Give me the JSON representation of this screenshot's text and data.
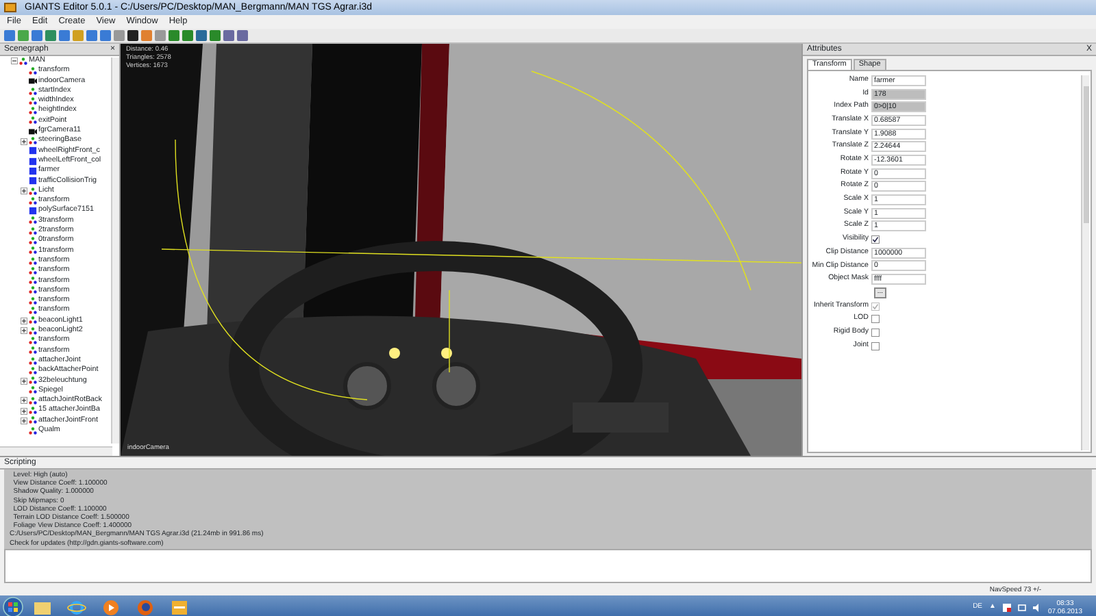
{
  "window": {
    "title": "GIANTS Editor 5.0.1 - C:/Users/PC/Desktop/MAN_Bergmann/MAN TGS Agrar.i3d"
  },
  "menu": [
    "File",
    "Edit",
    "Create",
    "View",
    "Window",
    "Help"
  ],
  "scenegraph": {
    "title": "Scenegraph",
    "close": "×",
    "tree": [
      {
        "label": "MAN",
        "kind": "transform",
        "expanded": true,
        "children": [
          {
            "label": "transform",
            "kind": "transform"
          },
          {
            "label": "indoorCamera",
            "kind": "camera"
          },
          {
            "label": "startIndex",
            "kind": "transform"
          },
          {
            "label": "widthIndex",
            "kind": "transform"
          },
          {
            "label": "heightIndex",
            "kind": "transform"
          },
          {
            "label": "exitPoint",
            "kind": "transform"
          },
          {
            "label": "fgrCamera11",
            "kind": "camera"
          },
          {
            "label": "steeringBase",
            "kind": "transform",
            "expanded": false
          },
          {
            "label": "wheelRightFront_c",
            "kind": "shape"
          },
          {
            "label": "wheelLeftFront_col",
            "kind": "shape"
          },
          {
            "label": "farmer",
            "kind": "shape"
          },
          {
            "label": "trafficCollisionTrig",
            "kind": "shape"
          },
          {
            "label": "Licht",
            "kind": "transform",
            "expanded": false
          },
          {
            "label": "transform",
            "kind": "transform"
          },
          {
            "label": "polySurface7151",
            "kind": "shape"
          },
          {
            "label": "3transform",
            "kind": "transform"
          },
          {
            "label": "2transform",
            "kind": "transform"
          },
          {
            "label": "0transform",
            "kind": "transform"
          },
          {
            "label": "1transform",
            "kind": "transform"
          },
          {
            "label": "transform",
            "kind": "transform"
          },
          {
            "label": "transform",
            "kind": "transform"
          },
          {
            "label": "transform",
            "kind": "transform"
          },
          {
            "label": "transform",
            "kind": "transform"
          },
          {
            "label": "transform",
            "kind": "transform"
          },
          {
            "label": "transform",
            "kind": "transform"
          },
          {
            "label": "beaconLight1",
            "kind": "transform",
            "expanded": false
          },
          {
            "label": "beaconLight2",
            "kind": "transform",
            "expanded": false
          },
          {
            "label": "transform",
            "kind": "transform"
          },
          {
            "label": "transform",
            "kind": "transform"
          },
          {
            "label": "attacherJoint",
            "kind": "transform"
          },
          {
            "label": "backAttacherPoint",
            "kind": "transform"
          },
          {
            "label": "32beleuchtung",
            "kind": "transform",
            "expanded": false
          },
          {
            "label": "Spiegel",
            "kind": "transform"
          },
          {
            "label": "attachJointRotBack",
            "kind": "transform",
            "expanded": false
          },
          {
            "label": "15 attacherJointBa",
            "kind": "transform",
            "expanded": false
          },
          {
            "label": "attacherJointFront",
            "kind": "transform",
            "expanded": false
          },
          {
            "label": "Qualm",
            "kind": "transform"
          }
        ]
      }
    ]
  },
  "viewport": {
    "stats": [
      "Distance: 0.46",
      "Triangles: 2578",
      "Vertices: 1673"
    ],
    "camera": "indoorCamera"
  },
  "attributes": {
    "title": "Attributes",
    "close": "X",
    "tabs": [
      {
        "label": "Transform",
        "selected": true
      },
      {
        "label": "Shape",
        "selected": false
      }
    ],
    "fields": [
      {
        "kind": "text",
        "label": "Name",
        "value": "farmer"
      },
      {
        "kind": "readonly",
        "label": "Id",
        "value": "178"
      },
      {
        "kind": "readonly",
        "label": "Index Path",
        "value": "0>0|10"
      },
      {
        "kind": "text",
        "label": "Translate X",
        "value": "0.68587"
      },
      {
        "kind": "text",
        "label": "Translate Y",
        "value": "1.9088"
      },
      {
        "kind": "text",
        "label": "Translate Z",
        "value": "2.24644"
      },
      {
        "kind": "text",
        "label": "Rotate X",
        "value": "-12.3601"
      },
      {
        "kind": "text",
        "label": "Rotate Y",
        "value": "0"
      },
      {
        "kind": "text",
        "label": "Rotate Z",
        "value": "0"
      },
      {
        "kind": "text",
        "label": "Scale X",
        "value": "1"
      },
      {
        "kind": "text",
        "label": "Scale Y",
        "value": "1"
      },
      {
        "kind": "text",
        "label": "Scale Z",
        "value": "1"
      },
      {
        "kind": "checkbox",
        "label": "Visibility",
        "checked": true
      },
      {
        "kind": "text",
        "label": "Clip Distance",
        "value": "1000000"
      },
      {
        "kind": "text",
        "label": "Min Clip Distance",
        "value": "0"
      },
      {
        "kind": "text",
        "label": "Object Mask",
        "value": "ffff"
      },
      {
        "kind": "button",
        "value": "..."
      },
      {
        "kind": "checkbox",
        "label": "Inherit Transform",
        "checked": true,
        "disabled": true
      },
      {
        "kind": "checkbox",
        "label": "LOD",
        "checked": false
      },
      {
        "kind": "checkbox",
        "label": "Rigid Body",
        "checked": false
      },
      {
        "kind": "checkbox",
        "label": "Joint",
        "checked": false
      }
    ]
  },
  "scripting": {
    "title": "Scripting",
    "log": [
      "  Level: High (auto)",
      "  View Distance Coeff: 1.100000",
      "  Shadow Quality: 1.000000",
      "  Skip Mipmaps: 0",
      "  LOD Distance Coeff: 1.100000",
      "  Terrain LOD Distance Coeff: 1.500000",
      "  Foliage View Distance Coeff: 1.400000",
      "C:/Users/PC/Desktop/MAN_Bergmann/MAN TGS Agrar.i3d (21.24mb in 991.86 ms)",
      "Check for updates (http://gdn.giants-software.com)"
    ]
  },
  "status_bar": "NavSpeed 73 +/-",
  "taskbar": {
    "language": "DE",
    "tray_arrow": "▲",
    "time": "08:33",
    "date": "07.06.2013"
  }
}
